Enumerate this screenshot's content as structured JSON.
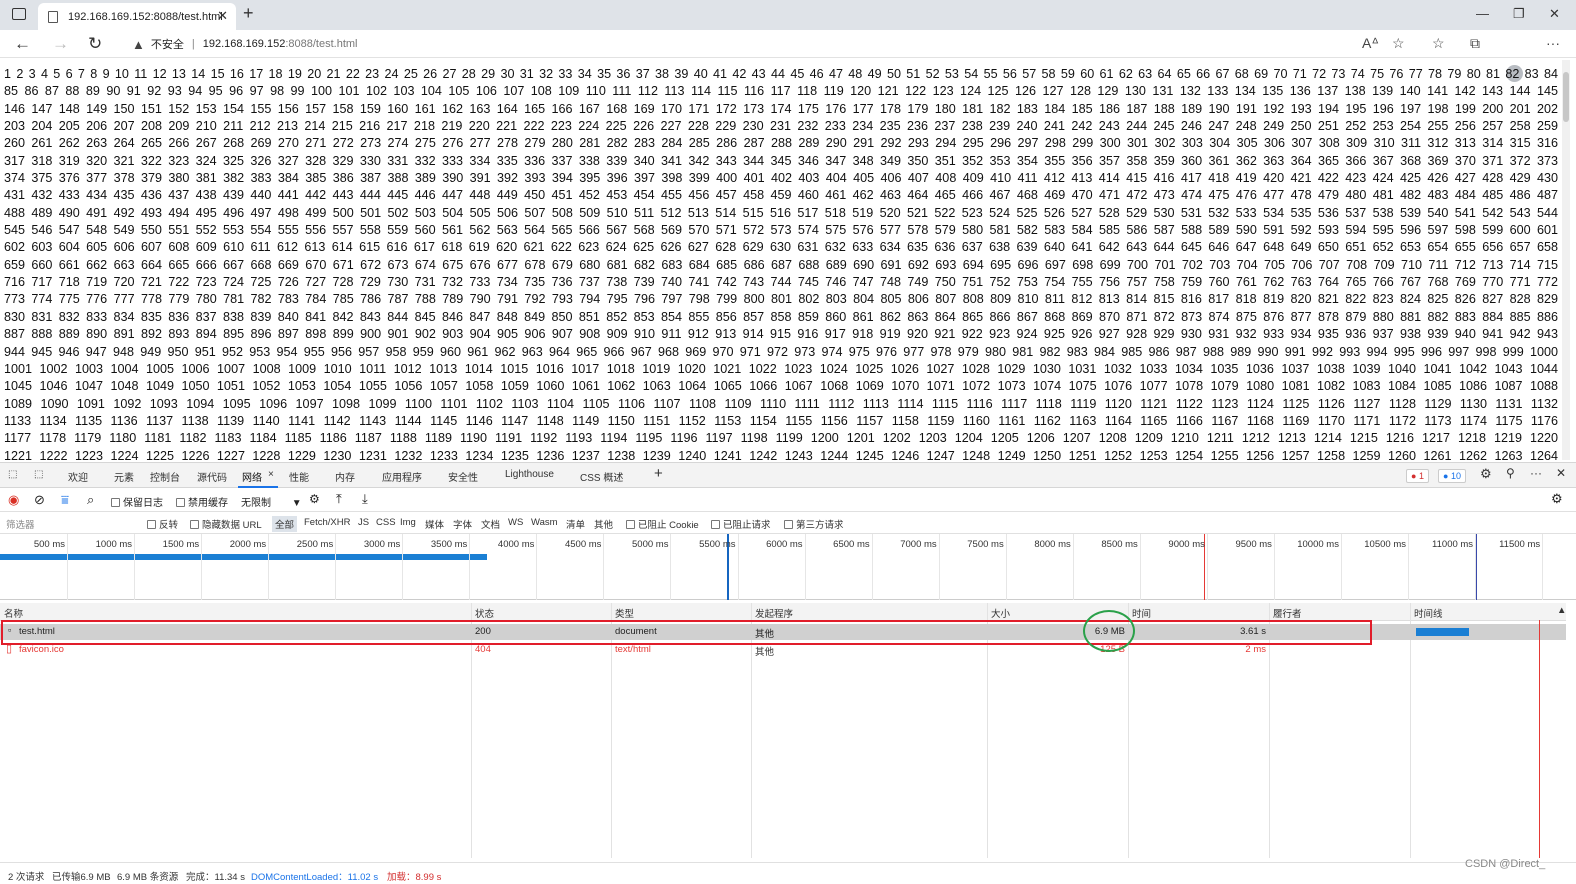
{
  "browser": {
    "tab_title": "192.168.169.152:8088/test.html",
    "security_label": "不安全",
    "url_host": "192.168.169.152",
    "url_path": ":8088/test.html"
  },
  "page": {
    "number_lines": [
      "1 2 3 4 5 6 7 8 9 10 11 12 13 14 15 16 17 18 19 20 21 22 23 24 25 26 27 28 29 30 31 32 33 34 35 36 37 38 39 40 41 42 43 44 45 46 47 48 49 50 51 52 53 54 55 56 57 58 59 60 61 62 63 64 65 66 67 68 69 70 71 72 73 74 75 76 77 78 79 80 81 82 83 84",
      "85 86 87 88 89 90 91 92 93 94 95 96 97 98 99 100 101 102 103 104 105 106 107 108 109 110 111 112 113 114 115 116 117 118 119 120 121 122 123 124 125 126 127 128 129 130 131 132 133 134 135 136 137 138 139 140 141 142 143 144 145",
      "146 147 148 149 150 151 152 153 154 155 156 157 158 159 160 161 162 163 164 165 166 167 168 169 170 171 172 173 174 175 176 177 178 179 180 181 182 183 184 185 186 187 188 189 190 191 192 193 194 195 196 197 198 199 200 201 202",
      "203 204 205 206 207 208 209 210 211 212 213 214 215 216 217 218 219 220 221 222 223 224 225 226 227 228 229 230 231 232 233 234 235 236 237 238 239 240 241 242 243 244 245 246 247 248 249 250 251 252 253 254 255 256 257 258 259",
      "260 261 262 263 264 265 266 267 268 269 270 271 272 273 274 275 276 277 278 279 280 281 282 283 284 285 286 287 288 289 290 291 292 293 294 295 296 297 298 299 300 301 302 303 304 305 306 307 308 309 310 311 312 313 314 315 316",
      "317 318 319 320 321 322 323 324 325 326 327 328 329 330 331 332 333 334 335 336 337 338 339 340 341 342 343 344 345 346 347 348 349 350 351 352 353 354 355 356 357 358 359 360 361 362 363 364 365 366 367 368 369 370 371 372 373",
      "374 375 376 377 378 379 380 381 382 383 384 385 386 387 388 389 390 391 392 393 394 395 396 397 398 399 400 401 402 403 404 405 406 407 408 409 410 411 412 413 414 415 416 417 418 419 420 421 422 423 424 425 426 427 428 429 430",
      "431 432 433 434 435 436 437 438 439 440 441 442 443 444 445 446 447 448 449 450 451 452 453 454 455 456 457 458 459 460 461 462 463 464 465 466 467 468 469 470 471 472 473 474 475 476 477 478 479 480 481 482 483 484 485 486 487",
      "488 489 490 491 492 493 494 495 496 497 498 499 500 501 502 503 504 505 506 507 508 509 510 511 512 513 514 515 516 517 518 519 520 521 522 523 524 525 526 527 528 529 530 531 532 533 534 535 536 537 538 539 540 541 542 543 544",
      "545 546 547 548 549 550 551 552 553 554 555 556 557 558 559 560 561 562 563 564 565 566 567 568 569 570 571 572 573 574 575 576 577 578 579 580 581 582 583 584 585 586 587 588 589 590 591 592 593 594 595 596 597 598 599 600 601",
      "602 603 604 605 606 607 608 609 610 611 612 613 614 615 616 617 618 619 620 621 622 623 624 625 626 627 628 629 630 631 632 633 634 635 636 637 638 639 640 641 642 643 644 645 646 647 648 649 650 651 652 653 654 655 656 657 658",
      "659 660 661 662 663 664 665 666 667 668 669 670 671 672 673 674 675 676 677 678 679 680 681 682 683 684 685 686 687 688 689 690 691 692 693 694 695 696 697 698 699 700 701 702 703 704 705 706 707 708 709 710 711 712 713 714 715",
      "716 717 718 719 720 721 722 723 724 725 726 727 728 729 730 731 732 733 734 735 736 737 738 739 740 741 742 743 744 745 746 747 748 749 750 751 752 753 754 755 756 757 758 759 760 761 762 763 764 765 766 767 768 769 770 771 772",
      "773 774 775 776 777 778 779 780 781 782 783 784 785 786 787 788 789 790 791 792 793 794 795 796 797 798 799 800 801 802 803 804 805 806 807 808 809 810 811 812 813 814 815 816 817 818 819 820 821 822 823 824 825 826 827 828 829",
      "830 831 832 833 834 835 836 837 838 839 840 841 842 843 844 845 846 847 848 849 850 851 852 853 854 855 856 857 858 859 860 861 862 863 864 865 866 867 868 869 870 871 872 873 874 875 876 877 878 879 880 881 882 883 884 885 886",
      "887 888 889 890 891 892 893 894 895 896 897 898 899 900 901 902 903 904 905 906 907 908 909 910 911 912 913 914 915 916 917 918 919 920 921 922 923 924 925 926 927 928 929 930 931 932 933 934 935 936 937 938 939 940 941 942 943",
      "944 945 946 947 948 949 950 951 952 953 954 955 956 957 958 959 960 961 962 963 964 965 966 967 968 969 970 971 972 973 974 975 976 977 978 979 980 981 982 983 984 985 986 987 988 989 990 991 992 993 994 995 996 997 998 999 1000",
      "1001 1002 1003 1004 1005 1006 1007 1008 1009 1010 1011 1012 1013 1014 1015 1016 1017 1018 1019 1020 1021 1022 1023 1024 1025 1026 1027 1028 1029 1030 1031 1032 1033 1034 1035 1036 1037 1038 1039 1040 1041 1042 1043 1044",
      "1045 1046 1047 1048 1049 1050 1051 1052 1053 1054 1055 1056 1057 1058 1059 1060 1061 1062 1063 1064 1065 1066 1067 1068 1069 1070 1071 1072 1073 1074 1075 1076 1077 1078 1079 1080 1081 1082 1083 1084 1085 1086 1087 1088",
      "1089 1090 1091 1092 1093 1094 1095 1096 1097 1098 1099 1100 1101 1102 1103 1104 1105 1106 1107 1108 1109 1110 1111 1112 1113 1114 1115 1116 1117 1118 1119 1120 1121 1122 1123 1124 1125 1126 1127 1128 1129 1130 1131 1132",
      "1133 1134 1135 1136 1137 1138 1139 1140 1141 1142 1143 1144 1145 1146 1147 1148 1149 1150 1151 1152 1153 1154 1155 1156 1157 1158 1159 1160 1161 1162 1163 1164 1165 1166 1167 1168 1169 1170 1171 1172 1173 1174 1175 1176",
      "1177 1178 1179 1180 1181 1182 1183 1184 1185 1186 1187 1188 1189 1190 1191 1192 1193 1194 1195 1196 1197 1198 1199 1200 1201 1202 1203 1204 1205 1206 1207 1208 1209 1210 1211 1212 1213 1214 1215 1216 1217 1218 1219 1220",
      "1221 1222 1223 1224 1225 1226 1227 1228 1229 1230 1231 1232 1233 1234 1235 1236 1237 1238 1239 1240 1241 1242 1243 1244 1245 1246 1247 1248 1249 1250 1251 1252 1253 1254 1255 1256 1257 1258 1259 1260 1261 1262 1263 1264"
    ]
  },
  "devtools": {
    "tabs": [
      "欢迎",
      "元素",
      "控制台",
      "源代码",
      "网络",
      "性能",
      "内存",
      "应用程序",
      "安全性",
      "Lighthouse",
      "CSS 概述"
    ],
    "active_tab": "网络",
    "error_count": "1",
    "message_count": "10",
    "toolbar": {
      "preserve_log": "保留日志",
      "disable_cache": "禁用缓存",
      "throttle": "无限制"
    },
    "filter": {
      "placeholder": "筛选器",
      "invert": "反转",
      "hide_data_urls": "隐藏数据 URL",
      "types": [
        "全部",
        "Fetch/XHR",
        "JS",
        "CSS",
        "Img",
        "媒体",
        "字体",
        "文档",
        "WS",
        "Wasm",
        "清单",
        "其他"
      ],
      "blocked_cookies": "已阻止 Cookie",
      "blocked_requests": "已阻止请求",
      "third_party": "第三方请求"
    },
    "overview_ticks": [
      "500 ms",
      "1000 ms",
      "1500 ms",
      "2000 ms",
      "2500 ms",
      "3000 ms",
      "3500 ms",
      "4000 ms",
      "4500 ms",
      "5000 ms",
      "5500 ms",
      "6000 ms",
      "6500 ms",
      "7000 ms",
      "7500 ms",
      "8000 ms",
      "8500 ms",
      "9000 ms",
      "9500 ms",
      "10000 ms",
      "10500 ms",
      "11000 ms",
      "11500 ms",
      "12"
    ],
    "columns": [
      "名称",
      "状态",
      "类型",
      "发起程序",
      "大小",
      "时间",
      "履行者",
      "时间线"
    ],
    "rows": [
      {
        "name": "test.html",
        "status": "200",
        "type": "document",
        "initiator": "其他",
        "size": "6.9 MB",
        "time": "3.61 s"
      },
      {
        "name": "favicon.ico",
        "status": "404",
        "type": "text/html",
        "initiator": "其他",
        "size": "125 B",
        "time": "2 ms"
      }
    ],
    "status_bar": {
      "requests": "2 次请求",
      "transferred": "已传输6.9 MB",
      "resources": "6.9 MB 条资源",
      "finish": "完成：11.34 s",
      "dcl": "DOMContentLoaded：11.02 s",
      "load": "加载：8.99 s"
    }
  },
  "watermark": "CSDN @Direct_"
}
